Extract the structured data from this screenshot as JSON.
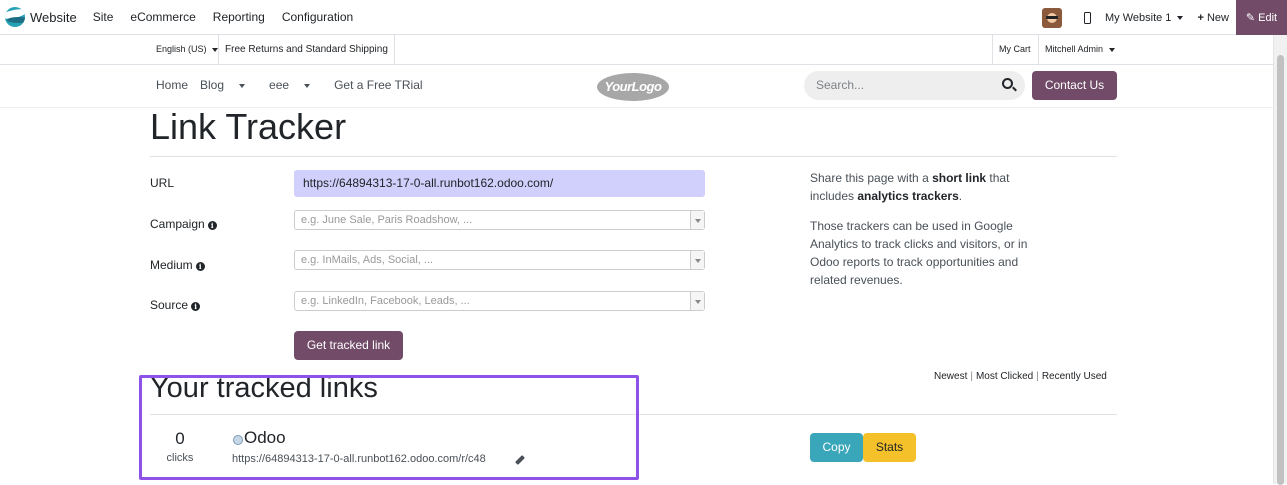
{
  "odoo_nav": {
    "app_name": "Website",
    "menu": [
      "Site",
      "eCommerce",
      "Reporting",
      "Configuration"
    ],
    "website_selector": "My Website 1",
    "new_label": "New",
    "edit_label": "Edit"
  },
  "topbar": {
    "language": "English (US)",
    "shipping_note": "Free Returns and Standard Shipping",
    "cart": "My Cart",
    "user": "Mitchell Admin"
  },
  "mainnav": {
    "links": [
      "Home",
      "Blog",
      "eee",
      "Get a Free TRial"
    ],
    "logo_text": "YourLogo",
    "search_placeholder": "Search...",
    "contact_button": "Contact Us"
  },
  "page": {
    "title": "Link Tracker",
    "form": {
      "url_label": "URL",
      "url_value": "https://64894313-17-0-all.runbot162.odoo.com/",
      "campaign_label": "Campaign",
      "campaign_placeholder": "e.g. June Sale, Paris Roadshow, ...",
      "medium_label": "Medium",
      "medium_placeholder": "e.g. InMails, Ads, Social, ...",
      "source_label": "Source",
      "source_placeholder": "e.g. LinkedIn, Facebook, Leads, ...",
      "submit_label": "Get tracked link"
    },
    "side": {
      "p1_pre": "Share this page with a ",
      "p1_b1": "short link",
      "p1_mid": " that includes ",
      "p1_b2": "analytics trackers",
      "p1_end": ".",
      "p2": "Those trackers can be used in Google Analytics to track clicks and visitors, or in Odoo reports to track opportunities and related revenues."
    },
    "tracked": {
      "title": "Your tracked links",
      "sort": [
        "Newest",
        "Most Clicked",
        "Recently Used"
      ],
      "items": [
        {
          "clicks": "0",
          "clicks_label": "clicks",
          "name": "Odoo",
          "short_url": "https://64894313-17-0-all.runbot162.odoo.com/r/c48",
          "copy_label": "Copy",
          "stats_label": "Stats"
        }
      ]
    }
  },
  "colors": {
    "primary": "#714b67",
    "url_highlight": "#d1cffb",
    "copy": "#3aa6ba",
    "stats": "#f4c12b",
    "annotation": "#8e52e8"
  }
}
